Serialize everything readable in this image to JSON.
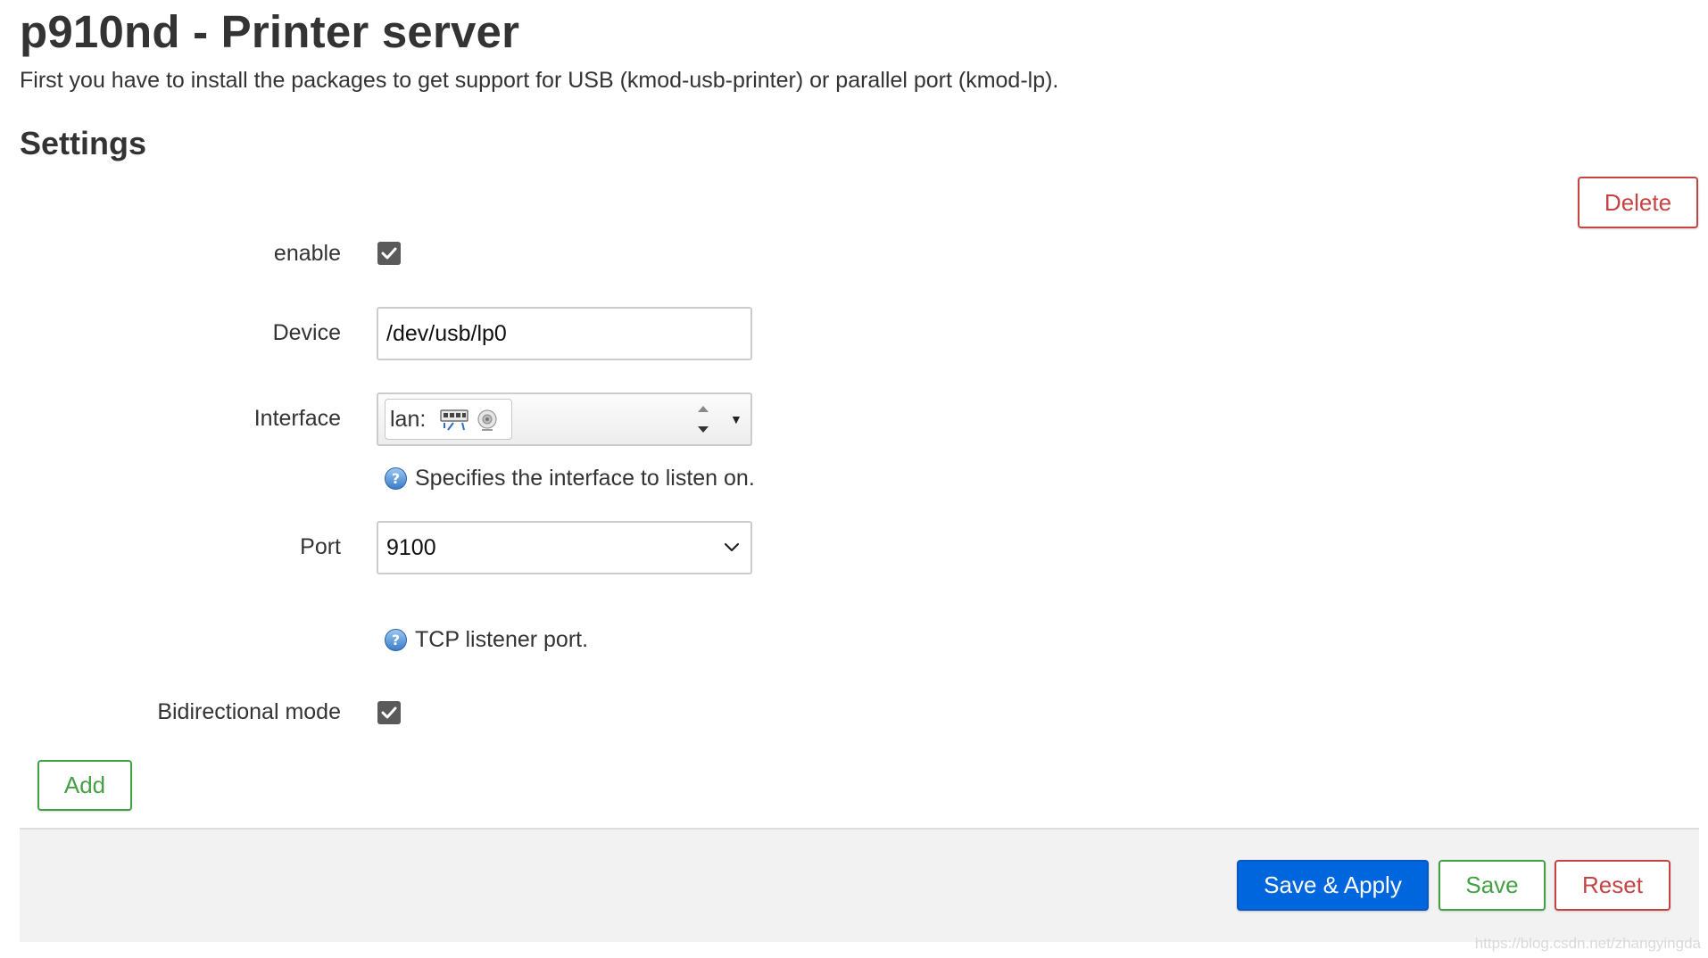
{
  "page": {
    "title": "p910nd - Printer server",
    "description": "First you have to install the packages to get support for USB (kmod-usb-printer) or parallel port (kmod-lp).",
    "section_title": "Settings"
  },
  "section": {
    "delete_label": "Delete",
    "add_label": "Add"
  },
  "form": {
    "enable": {
      "label": "enable",
      "checked": true
    },
    "device": {
      "label": "Device",
      "value": "/dev/usb/lp0"
    },
    "interface": {
      "label": "Interface",
      "value": "lan:",
      "icons": [
        "network-port-icon",
        "wireless-icon"
      ],
      "help": "Specifies the interface to listen on."
    },
    "port": {
      "label": "Port",
      "value": "9100",
      "help": "TCP listener port."
    },
    "bidirectional": {
      "label": "Bidirectional mode",
      "checked": true
    }
  },
  "footer": {
    "save_apply_label": "Save & Apply",
    "save_label": "Save",
    "reset_label": "Reset"
  },
  "watermark": "https://blog.csdn.net/zhangyingda",
  "colors": {
    "primary": "#0066dd",
    "positive": "#44a044",
    "negative": "#c44444",
    "text": "#333333"
  }
}
